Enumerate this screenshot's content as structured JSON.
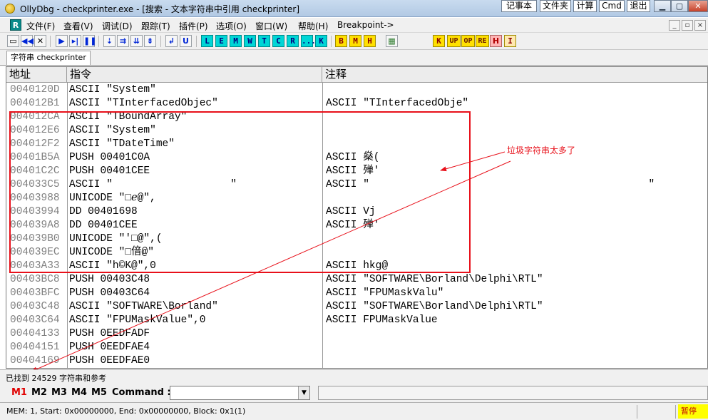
{
  "window": {
    "title": "OllyDbg - checkprinter.exe - [搜索 - 文本字符串中引用 checkprinter]",
    "top_buttons": [
      "记事本",
      "文件夹",
      "计算",
      "Cmd",
      "退出"
    ]
  },
  "menu": {
    "items": [
      "文件(F)",
      "查看(V)",
      "调试(D)",
      "跟踪(T)",
      "插件(P)",
      "选项(O)",
      "窗口(W)",
      "帮助(H)",
      "Breakpoint->"
    ]
  },
  "toolbar": {
    "letter_buttons": [
      "L",
      "E",
      "M",
      "W",
      "T",
      "C",
      "R",
      "...",
      "K"
    ],
    "view_buttons": [
      "B",
      "M",
      "H"
    ],
    "plugin_buttons": [
      "K",
      "UP",
      "OP",
      "RE",
      "H",
      "I"
    ]
  },
  "tab": {
    "label": "字符串 checkprinter"
  },
  "grid": {
    "headers": [
      "地址",
      "指令",
      "注释"
    ],
    "rows": [
      {
        "addr": "0040120D",
        "instr": "ASCII \"System\"",
        "comment": ""
      },
      {
        "addr": "004012B1",
        "instr": "ASCII \"TInterfacedObjec\"",
        "comment": "ASCII \"TInterfacedObje\""
      },
      {
        "addr": "004012CA",
        "instr": "ASCII \"TBoundArray\"",
        "comment": ""
      },
      {
        "addr": "004012E6",
        "instr": "ASCII \"System\"",
        "comment": ""
      },
      {
        "addr": "004012F2",
        "instr": "ASCII \"TDateTime\"",
        "comment": ""
      },
      {
        "addr": "00401B5A",
        "instr": "PUSH 00401C0A",
        "comment": "ASCII 燊("
      },
      {
        "addr": "00401C2C",
        "instr": "PUSH 00401CEE",
        "comment": "ASCII 殚'"
      },
      {
        "addr": "004033C5",
        "instr": "ASCII \"                   \"",
        "comment": "ASCII \"                                             \""
      },
      {
        "addr": "00403988",
        "instr": "UNICODE \"□ℯ@\",",
        "comment": ""
      },
      {
        "addr": "00403994",
        "instr": "DD 00401698",
        "comment": "ASCII Vj"
      },
      {
        "addr": "004039A8",
        "instr": "DD 00401CEE",
        "comment": "ASCII 殚'"
      },
      {
        "addr": "004039B0",
        "instr": "UNICODE \"'□@\",(",
        "comment": ""
      },
      {
        "addr": "004039EC",
        "instr": "UNICODE \"□偣@\"",
        "comment": ""
      },
      {
        "addr": "00403A33",
        "instr": "ASCII \"h©K@\",0",
        "comment": "ASCII hkg@"
      },
      {
        "addr": "00403BC8",
        "instr": "PUSH 00403C48",
        "comment": "ASCII \"SOFTWARE\\Borland\\Delphi\\RTL\""
      },
      {
        "addr": "00403BFC",
        "instr": "PUSH 00403C64",
        "comment": "ASCII \"FPUMaskValu\""
      },
      {
        "addr": "00403C48",
        "instr": "ASCII \"SOFTWARE\\Borland\"",
        "comment": "ASCII \"SOFTWARE\\Borland\\Delphi\\RTL\""
      },
      {
        "addr": "00403C64",
        "instr": "ASCII \"FPUMaskValue\",0",
        "comment": "ASCII FPUMaskValue"
      },
      {
        "addr": "00404133",
        "instr": "PUSH 0EEDFADF",
        "comment": ""
      },
      {
        "addr": "00404151",
        "instr": "PUSH 0EEDFAE4",
        "comment": ""
      },
      {
        "addr": "00404169",
        "instr": "PUSH 0EEDFAE0",
        "comment": ""
      }
    ]
  },
  "annotation": {
    "label": "垃圾字符串太多了",
    "color": "#e8101a"
  },
  "status": {
    "found": "已找到 24529 字符串和参考",
    "mem": "MEM: 1, Start: 0x00000000, End: 0x00000000, Block: 0x1(1)",
    "state": "暂停"
  },
  "command": {
    "m_buttons": [
      "M1",
      "M2",
      "M3",
      "M4",
      "M5"
    ],
    "label": "Command :",
    "value": ""
  }
}
